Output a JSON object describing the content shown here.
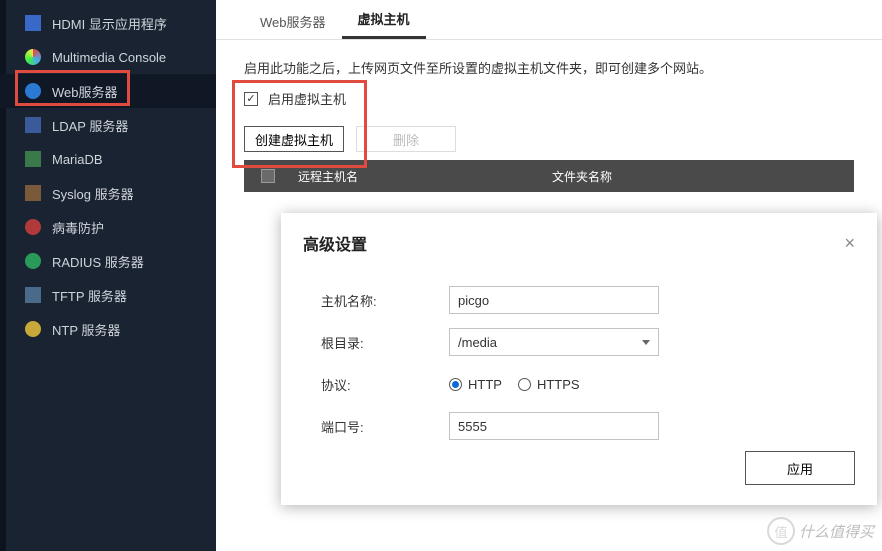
{
  "sidebar": {
    "items": [
      {
        "label": "HDMI 显示应用程序"
      },
      {
        "label": "Multimedia Console"
      },
      {
        "label": "Web服务器"
      },
      {
        "label": "LDAP 服务器"
      },
      {
        "label": "MariaDB"
      },
      {
        "label": "Syslog 服务器"
      },
      {
        "label": "病毒防护"
      },
      {
        "label": "RADIUS 服务器"
      },
      {
        "label": "TFTP 服务器"
      },
      {
        "label": "NTP 服务器"
      }
    ]
  },
  "tabs": {
    "web_server": "Web服务器",
    "virtual_host": "虚拟主机"
  },
  "description": "启用此功能之后，上传网页文件至所设置的虚拟主机文件夹，即可创建多个网站。",
  "vhost": {
    "enable_label": "启用虚拟主机",
    "create_btn": "创建虚拟主机",
    "delete_btn": "删除",
    "col_hostname": "远程主机名",
    "col_folder": "文件夹名称"
  },
  "modal": {
    "title": "高级设置",
    "host_label": "主机名称:",
    "host_value": "picgo",
    "root_label": "根目录:",
    "root_value": "/media",
    "proto_label": "协议:",
    "proto_http": "HTTP",
    "proto_https": "HTTPS",
    "port_label": "端口号:",
    "port_value": "5555",
    "apply": "应用"
  },
  "watermark": "什么值得买"
}
